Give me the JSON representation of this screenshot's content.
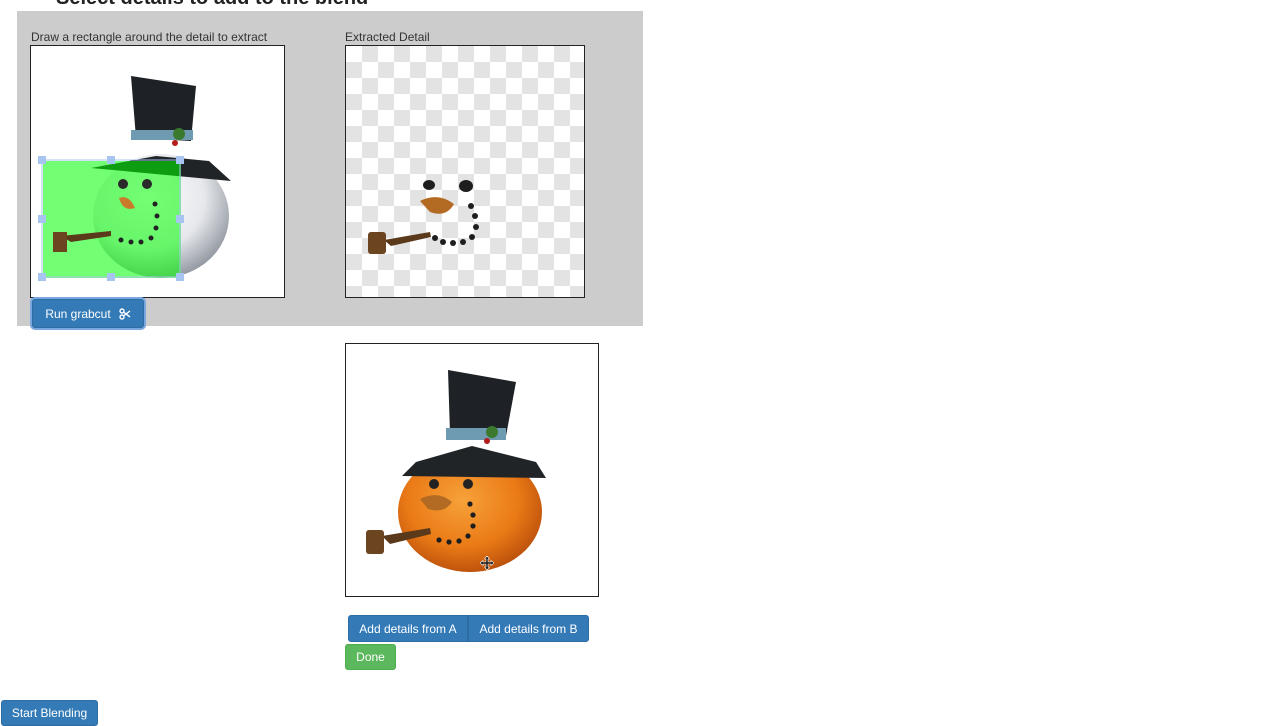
{
  "page": {
    "heading": "Select details to add to the blend"
  },
  "extract": {
    "source_caption": "Draw a rectangle around the detail to extract",
    "result_caption": "Extracted Detail",
    "run_grabcut_label": "Run grabcut",
    "run_grabcut_icon": "scissors-icon"
  },
  "blend": {
    "add_a_label": "Add details from A",
    "add_b_label": "Add details from B",
    "done_label": "Done"
  },
  "footer": {
    "start_label": "Start Blending"
  },
  "colors": {
    "primary": "#337ab7",
    "success": "#5cb85c",
    "panel": "#cccccc",
    "selection": "#00ff00",
    "handle": "#a8c4f0"
  },
  "cursor": "move-cursor-icon"
}
